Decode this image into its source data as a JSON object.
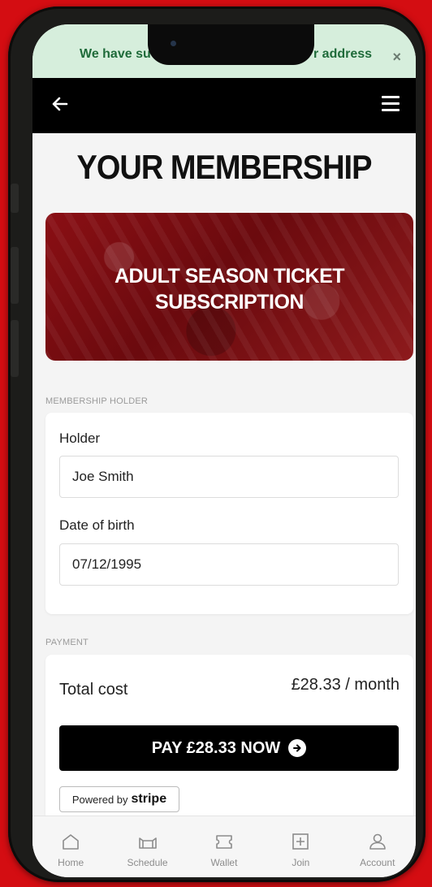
{
  "banner": {
    "message_left": "We have su",
    "message_right": "r address",
    "close_glyph": "×",
    "color": "#d6eedc"
  },
  "topbar": {
    "back_icon": "arrow-left-icon",
    "menu_icon": "hamburger-menu-icon"
  },
  "page": {
    "title": "YOUR MEMBERSHIP"
  },
  "hero": {
    "title_line1": "ADULT SEASON TICKET",
    "title_line2": "SUBSCRIPTION"
  },
  "membership_holder": {
    "section_label": "MEMBERSHIP HOLDER",
    "holder_label": "Holder",
    "holder_value": "Joe Smith",
    "dob_label": "Date of birth",
    "dob_value": "07/12/1995"
  },
  "payment": {
    "section_label": "PAYMENT",
    "total_label": "Total cost",
    "total_value": "£28.33 / month",
    "pay_button_label": "PAY £28.33 NOW",
    "powered_by_label": "Powered by",
    "stripe_label": "stripe"
  },
  "bottom_nav": {
    "items": [
      {
        "label": "Home",
        "icon": "home-icon"
      },
      {
        "label": "Schedule",
        "icon": "stadium-icon"
      },
      {
        "label": "Wallet",
        "icon": "ticket-icon"
      },
      {
        "label": "Join",
        "icon": "plus-box-icon"
      },
      {
        "label": "Account",
        "icon": "user-icon"
      }
    ]
  },
  "colors": {
    "background": "#d40d12",
    "hero": "#7a0c10",
    "button": "#000000",
    "banner_text": "#1f6b3a"
  }
}
